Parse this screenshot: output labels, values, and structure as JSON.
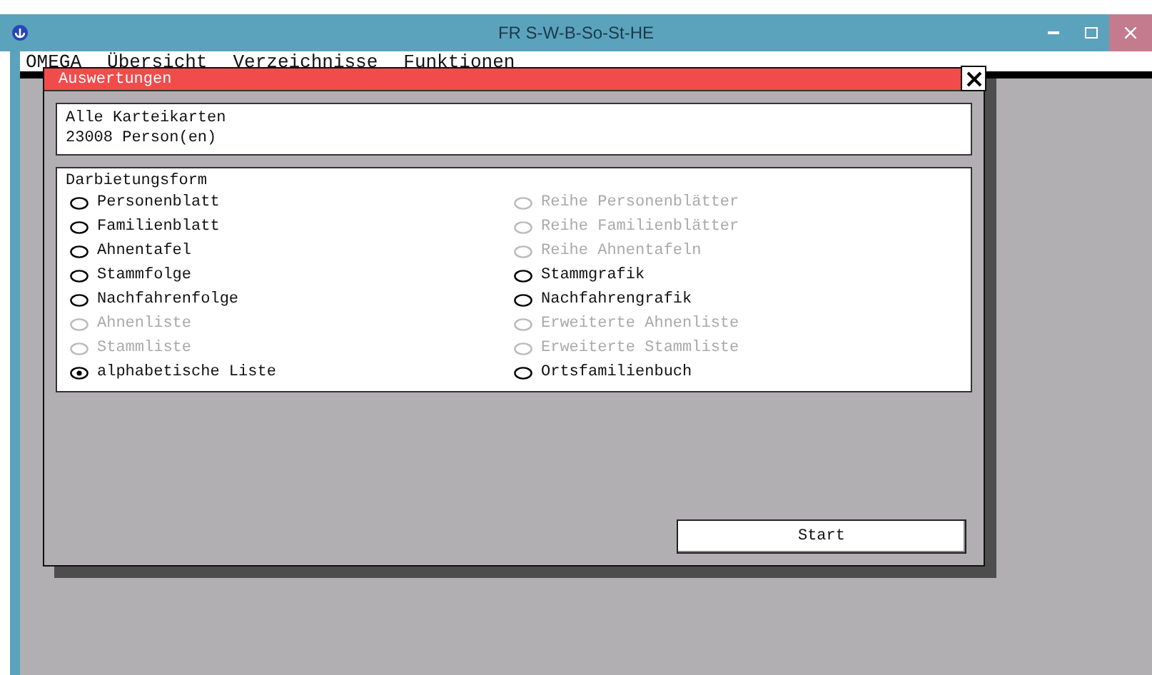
{
  "window": {
    "title": "FR S-W-B-So-St-HE"
  },
  "menu": [
    "OMEGA",
    "Übersicht",
    "Verzeichnisse",
    "Funktionen"
  ],
  "dialog": {
    "title": "Auswertungen",
    "info": [
      "Alle Karteikarten",
      "23008 Person(en)"
    ],
    "group_label": "Darbietungsform",
    "options_left": [
      {
        "label": "Personenblatt",
        "disabled": false,
        "selected": false
      },
      {
        "label": "Familienblatt",
        "disabled": false,
        "selected": false
      },
      {
        "label": "Ahnentafel",
        "disabled": false,
        "selected": false
      },
      {
        "label": "Stammfolge",
        "disabled": false,
        "selected": false
      },
      {
        "label": "Nachfahrenfolge",
        "disabled": false,
        "selected": false
      },
      {
        "label": "Ahnenliste",
        "disabled": true,
        "selected": false
      },
      {
        "label": "Stammliste",
        "disabled": true,
        "selected": false
      },
      {
        "label": "alphabetische Liste",
        "disabled": false,
        "selected": true
      }
    ],
    "options_right": [
      {
        "label": "Reihe Personenblätter",
        "disabled": true,
        "selected": false
      },
      {
        "label": "Reihe Familienblätter",
        "disabled": true,
        "selected": false
      },
      {
        "label": "Reihe Ahnentafeln",
        "disabled": true,
        "selected": false
      },
      {
        "label": "Stammgrafik",
        "disabled": false,
        "selected": false
      },
      {
        "label": "Nachfahrengrafik",
        "disabled": false,
        "selected": false
      },
      {
        "label": "Erweiterte Ahnenliste",
        "disabled": true,
        "selected": false
      },
      {
        "label": "Erweiterte Stammliste",
        "disabled": true,
        "selected": false
      },
      {
        "label": "Ortsfamilienbuch",
        "disabled": false,
        "selected": false
      }
    ],
    "button": "Start"
  }
}
